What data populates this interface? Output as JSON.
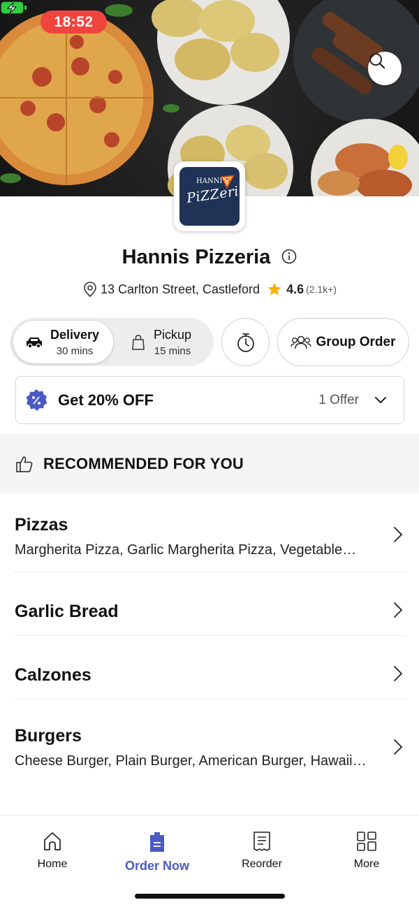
{
  "status_bar": {
    "time": "18:52"
  },
  "restaurant": {
    "logo_small_text": "HANNI'S",
    "logo_text": "PiZZeria",
    "name": "Hannis Pizzeria",
    "address": "13 Carlton Street, Castleford",
    "rating": "4.6",
    "rating_count": "(2.1k+)"
  },
  "order_mode": {
    "delivery": {
      "label": "Delivery",
      "time": "30 mins",
      "selected": true
    },
    "pickup": {
      "label": "Pickup",
      "time": "15 mins",
      "selected": false
    },
    "group_order_label": "Group Order"
  },
  "offer": {
    "title": "Get 20% OFF",
    "count": "1 Offer"
  },
  "recommended": {
    "label": "RECOMMENDED FOR YOU"
  },
  "categories": [
    {
      "name": "Pizzas",
      "items": "Margherita Pizza, Garlic Margherita Pizza,  Vegetable…"
    },
    {
      "name": "Garlic Bread",
      "items": ""
    },
    {
      "name": "Calzones",
      "items": ""
    },
    {
      "name": "Burgers",
      "items": "Cheese Burger, Plain Burger, American Burger, Hawaii…"
    }
  ],
  "bottom_nav": [
    {
      "label": "Home",
      "icon": "home-icon",
      "active": false
    },
    {
      "label": "Order Now",
      "icon": "order-bag-icon",
      "active": true
    },
    {
      "label": "Reorder",
      "icon": "receipt-icon",
      "active": false
    },
    {
      "label": "More",
      "icon": "grid-icon",
      "active": false
    }
  ],
  "colors": {
    "accent": "#4a5bc6",
    "status_time_bg": "#f0443f",
    "star": "#f5b301",
    "battery": "#2ecc40"
  }
}
